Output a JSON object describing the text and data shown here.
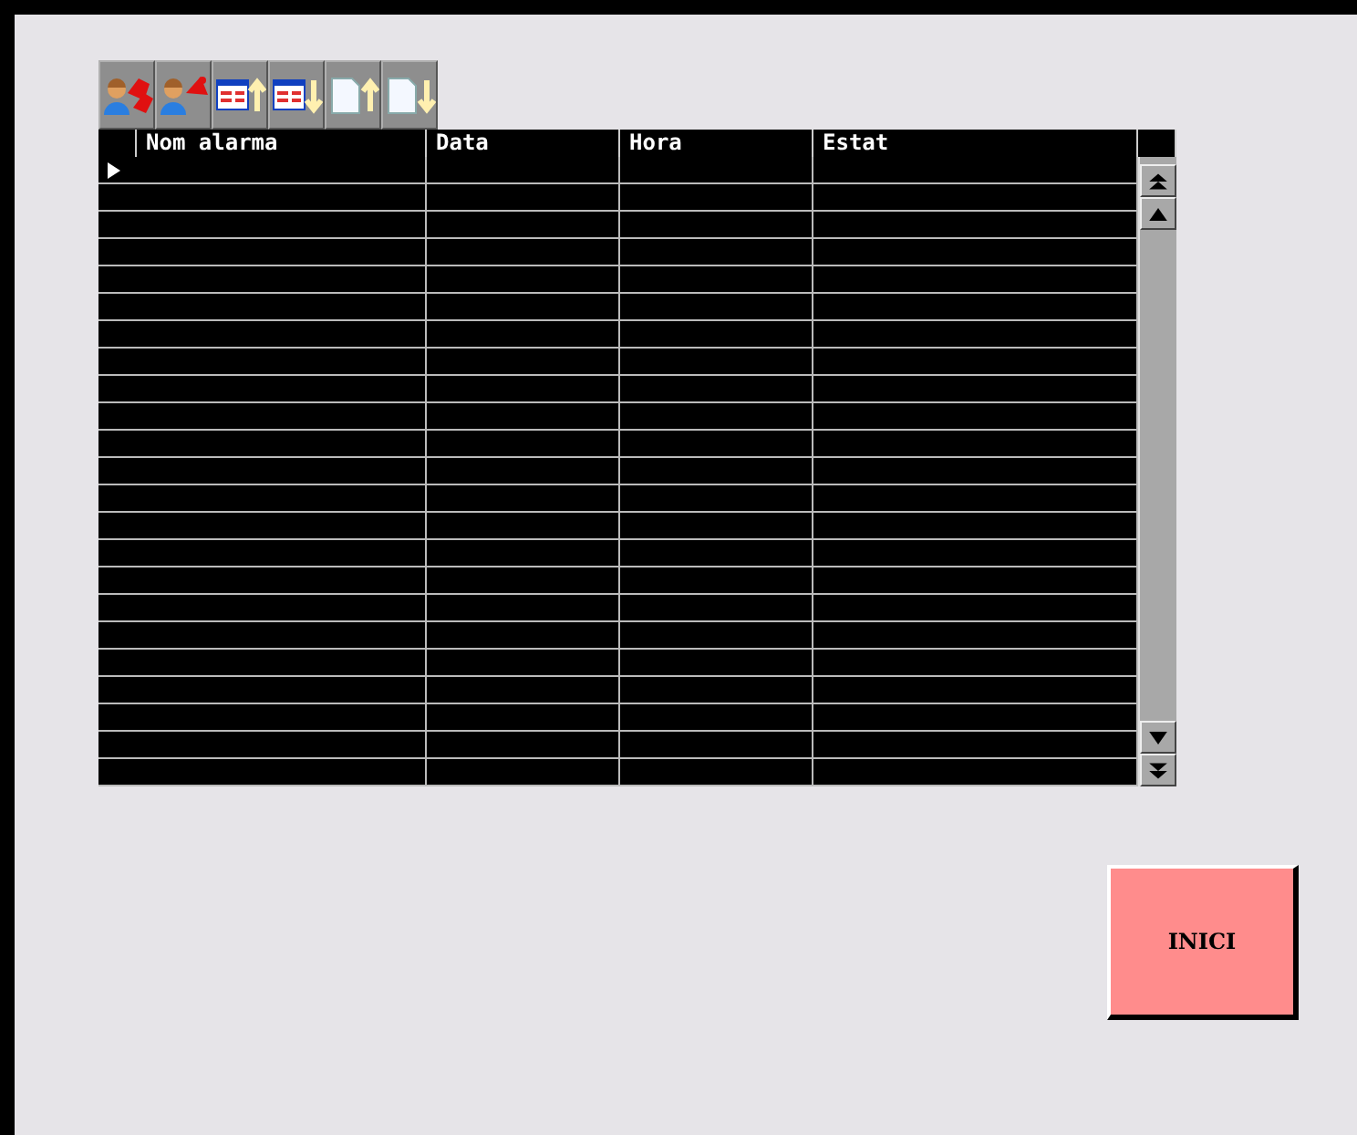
{
  "table": {
    "columns": [
      "Nom alarma",
      "Data",
      "Hora",
      "Estat"
    ],
    "rows": [
      {
        "selected": true
      },
      {
        "selected": false
      },
      {
        "selected": false
      },
      {
        "selected": false
      },
      {
        "selected": false
      },
      {
        "selected": false
      },
      {
        "selected": false
      },
      {
        "selected": false
      },
      {
        "selected": false
      },
      {
        "selected": false
      },
      {
        "selected": false
      },
      {
        "selected": false
      },
      {
        "selected": false
      },
      {
        "selected": false
      },
      {
        "selected": false
      },
      {
        "selected": false
      },
      {
        "selected": false
      },
      {
        "selected": false
      },
      {
        "selected": false
      },
      {
        "selected": false
      },
      {
        "selected": false
      },
      {
        "selected": false
      },
      {
        "selected": false
      }
    ]
  },
  "button": {
    "label": "INICI"
  }
}
